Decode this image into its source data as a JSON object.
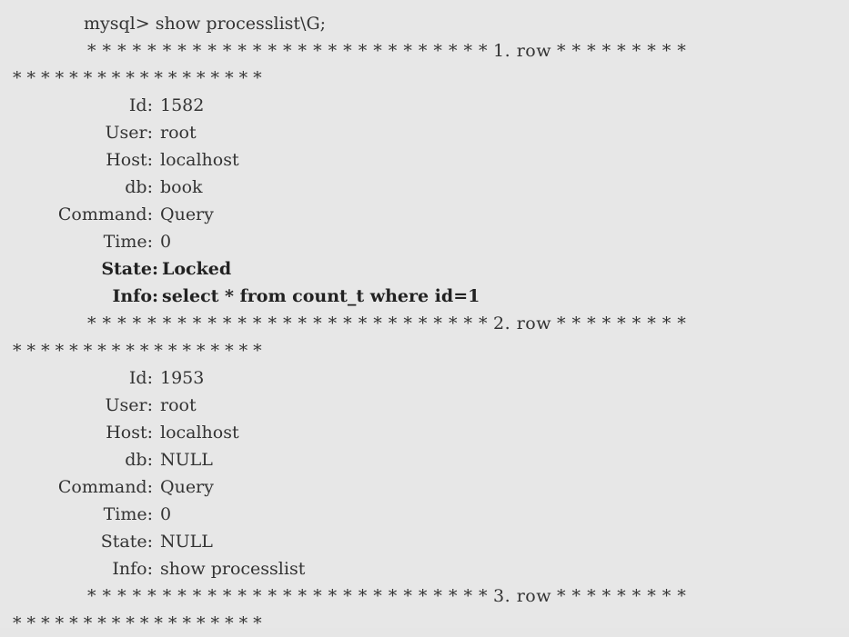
{
  "terminal": {
    "prompt": "mysql> show processlist\\G;",
    "rows": [
      {
        "header_stars_left": "* * * * * * * * * * * * * * * * * * * * * * * * * * *",
        "label": "1. row",
        "header_stars_right": "* * * * * * * * *",
        "trailing_stars": "* * * * * * * * * * * * * * * * * *",
        "fields": [
          {
            "name": "Id:",
            "value": "1582"
          },
          {
            "name": "User:",
            "value": "root"
          },
          {
            "name": "Host:",
            "value": "localhost"
          },
          {
            "name": "db:",
            "value": "book"
          },
          {
            "name": "Command:",
            "value": "Query"
          },
          {
            "name": "Time:",
            "value": "0"
          },
          {
            "name": "State:",
            "value": "Locked"
          },
          {
            "name": "Info:",
            "value": "select * from count_t where id=1"
          }
        ]
      },
      {
        "header_stars_left": "* * * * * * * * * * * * * * * * * * * * * * * * * * *",
        "label": "2. row",
        "header_stars_right": "* * * * * * * * *",
        "trailing_stars": "* * * * * * * * * * * * * * * * * *",
        "fields": [
          {
            "name": "Id:",
            "value": "1953"
          },
          {
            "name": "User:",
            "value": "root"
          },
          {
            "name": "Host:",
            "value": "localhost"
          },
          {
            "name": "db:",
            "value": "NULL"
          },
          {
            "name": "Command:",
            "value": "Query"
          },
          {
            "name": "Time:",
            "value": "0"
          },
          {
            "name": "State:",
            "value": "NULL"
          },
          {
            "name": "Info:",
            "value": "show processlist"
          }
        ]
      },
      {
        "header_stars_left": "* * * * * * * * * * * * * * * * * * * * * * * * * * *",
        "label": "3. row",
        "header_stars_right": "* * * * * * * * *",
        "trailing_stars": "* * * * * * * * * * * * * * * * * *"
      }
    ]
  }
}
